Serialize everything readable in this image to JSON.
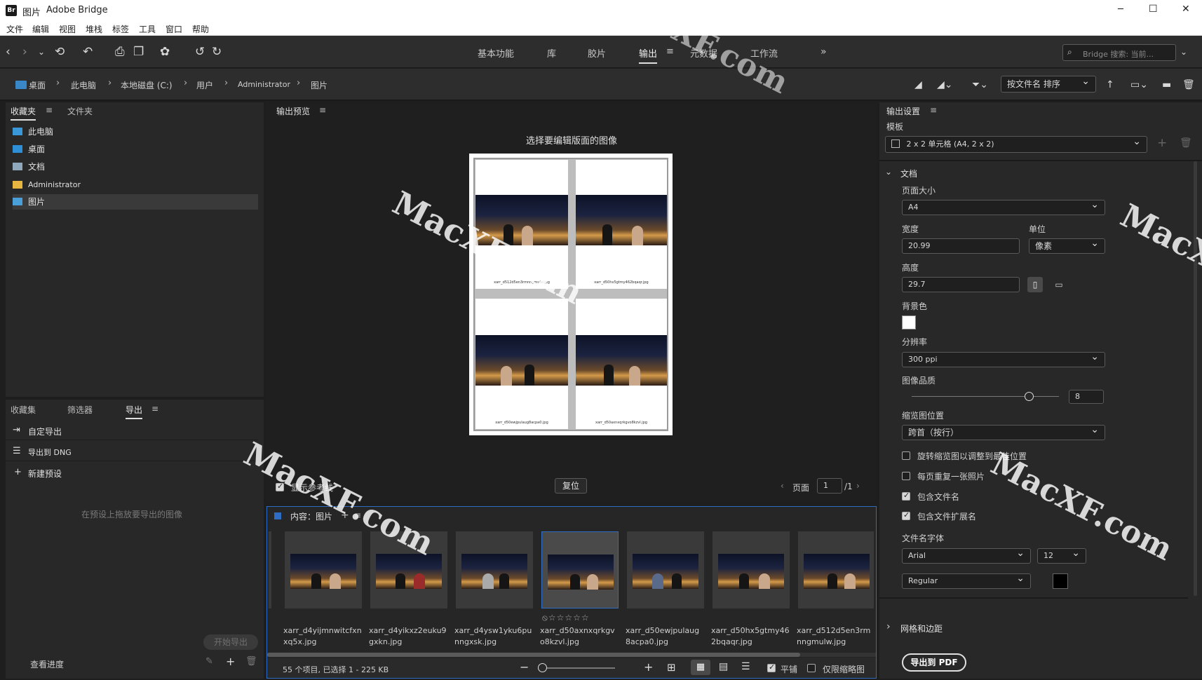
{
  "window": {
    "title": "图片",
    "app": "Adobe Bridge",
    "icon_text": "Br",
    "min": "─",
    "max": "☐",
    "close": "✕"
  },
  "menu": [
    "文件",
    "编辑",
    "视图",
    "堆栈",
    "标签",
    "工具",
    "窗口",
    "帮助"
  ],
  "workspaces": [
    "基本功能",
    "库",
    "胶片",
    "输出",
    "元数据",
    "工作流"
  ],
  "active_workspace": "输出",
  "search": {
    "placeholder": "Bridge 搜索: 当前..."
  },
  "breadcrumb": [
    "桌面",
    "此电脑",
    "本地磁盘 (C:)",
    "用户",
    "Administrator",
    "图片"
  ],
  "sort": {
    "label": "按文件名 排序"
  },
  "left_top": {
    "tabs": [
      "收藏夹",
      "文件夹"
    ],
    "favorites": [
      {
        "label": "此电脑",
        "icon": "computer-icon"
      },
      {
        "label": "桌面",
        "icon": "desktop-icon"
      },
      {
        "label": "文档",
        "icon": "documents-icon"
      },
      {
        "label": "Administrator",
        "icon": "folder-icon"
      },
      {
        "label": "图片",
        "icon": "pictures-icon"
      }
    ]
  },
  "left_bottom": {
    "tabs": [
      "收藏集",
      "筛选器",
      "导出"
    ],
    "items": [
      "自定导出",
      "导出到 DNG",
      "新建预设"
    ],
    "hint": "在预设上拖放要导出的图像",
    "start_export": "开始导出",
    "progress": "查看进度"
  },
  "preview": {
    "title": "输出预览",
    "instruction": "选择要编辑版面的图像",
    "captions": [
      "xarr_d512d5en3rmnngmulw.jpg",
      "xarr_d50hx5gtmy462bqaqr.jpg",
      "xarr_d50ewjpulaug8acpa0.jpg",
      "xarr_d50axnxqrkgvo8kzvl.jpg"
    ],
    "show_guides": "显示参考线",
    "reset": "复位",
    "page_label": "页面",
    "page_value": "1",
    "page_total": "/1"
  },
  "content": {
    "title": "内容：图片",
    "thumbs": [
      {
        "name": "xarr_d4yijmnwitcfxnxq5x.jpg"
      },
      {
        "name": "xarr_d4yikxz2euku9gxkn.jpg"
      },
      {
        "name": "xarr_d4ysw1yku6punngxsk.jpg"
      },
      {
        "name": "xarr_d50axnxqrkgvo8kzvl.jpg"
      },
      {
        "name": "xarr_d50ewjpulaug8acpa0.jpg"
      },
      {
        "name": "xarr_d50hx5gtmy462bqaqr.jpg"
      },
      {
        "name": "xarr_d512d5en3rmnngmulw.jpg"
      }
    ],
    "stars": "⦸☆☆☆☆☆",
    "status": "55 个项目, 已选择 1 - 225 KB",
    "tile_label": "平铺",
    "thumbs_only_label": "仅限缩略图"
  },
  "output": {
    "title": "输出设置",
    "template_label": "模板",
    "template_value": "2 x 2 单元格 (A4, 2 x 2)",
    "doc_section": "文档",
    "page_size_label": "页面大小",
    "page_size": "A4",
    "width_label": "宽度",
    "width": "20.99",
    "unit_label": "单位",
    "unit": "像素",
    "height_label": "高度",
    "height": "29.7",
    "bg_label": "背景色",
    "res_label": "分辨率",
    "res": "300 ppi",
    "quality_label": "图像品质",
    "quality": "8",
    "quality_level": 0.8,
    "thumb_pos_label": "缩览图位置",
    "thumb_pos": "跨首（按行）",
    "checks": [
      {
        "label": "旋转缩览图以调整到最佳位置",
        "on": false
      },
      {
        "label": "每页重复一张照片",
        "on": false
      },
      {
        "label": "包含文件名",
        "on": true
      },
      {
        "label": "包含文件扩展名",
        "on": true
      }
    ],
    "font_label": "文件名字体",
    "font": "Arial",
    "font_size": "12",
    "font_style": "Regular",
    "grid_section": "网格和边距",
    "export_pdf": "导出到 PDF"
  },
  "watermarks": [
    "MacXF.com",
    "MacXF.com",
    "MacXF.com",
    "MacXF.com",
    "MacXF.com"
  ]
}
